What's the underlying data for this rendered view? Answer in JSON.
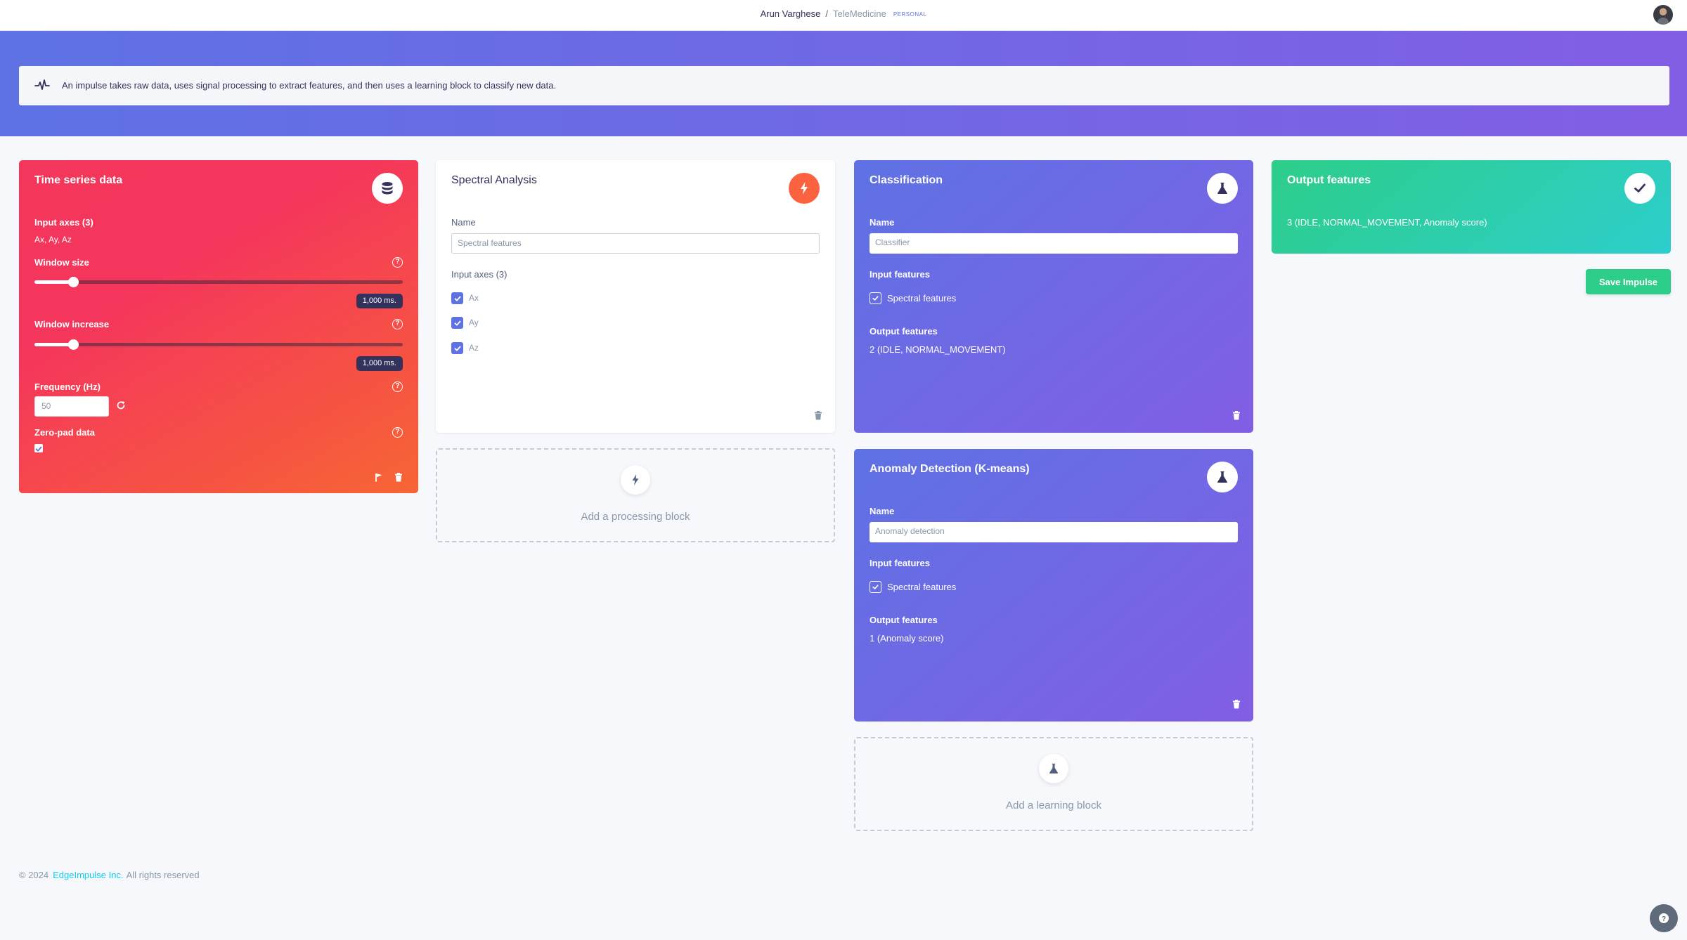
{
  "topbar": {
    "user": "Arun Varghese",
    "separator": "/",
    "project": "TeleMedicine",
    "badge": "PERSONAL"
  },
  "info": {
    "text": "An impulse takes raw data, uses signal processing to extract features, and then uses a learning block to classify new data."
  },
  "time_series": {
    "title": "Time series data",
    "input_axes_label": "Input axes (3)",
    "input_axes_value": "Ax, Ay, Az",
    "window_size_label": "Window size",
    "window_size_value": "1,000 ms.",
    "window_size_level": 0.105,
    "window_increase_label": "Window increase",
    "window_increase_value": "1,000 ms.",
    "window_increase_level": 0.105,
    "frequency_label": "Frequency (Hz)",
    "frequency_value": "50",
    "zero_pad_label": "Zero-pad data",
    "zero_pad_checked": true
  },
  "spectral": {
    "title": "Spectral Analysis",
    "name_label": "Name",
    "name_value": "Spectral features",
    "input_axes_label": "Input axes (3)",
    "axes": [
      "Ax",
      "Ay",
      "Az"
    ]
  },
  "add_processing": {
    "label": "Add a processing block"
  },
  "classification": {
    "title": "Classification",
    "name_label": "Name",
    "name_value": "Classifier",
    "input_features_label": "Input features",
    "input_feature": "Spectral features",
    "output_features_label": "Output features",
    "output_features_value": "2 (IDLE, NORMAL_MOVEMENT)"
  },
  "anomaly": {
    "title": "Anomaly Detection (K-means)",
    "name_label": "Name",
    "name_value": "Anomaly detection",
    "input_features_label": "Input features",
    "input_feature": "Spectral features",
    "output_features_label": "Output features",
    "output_features_value": "1 (Anomaly score)"
  },
  "add_learning": {
    "label": "Add a learning block"
  },
  "output": {
    "title": "Output features",
    "value": "3 (IDLE, NORMAL_MOVEMENT, Anomaly score)"
  },
  "save_button": {
    "label": "Save Impulse"
  },
  "footer": {
    "copyright": "© 2024",
    "brand": "EdgeImpulse Inc.",
    "rights": "All rights reserved"
  },
  "colors": {
    "primary": "#5e72e4",
    "danger": "#f5365c",
    "orange": "#fb6340",
    "success": "#2dce89",
    "teal": "#2dcecc"
  }
}
